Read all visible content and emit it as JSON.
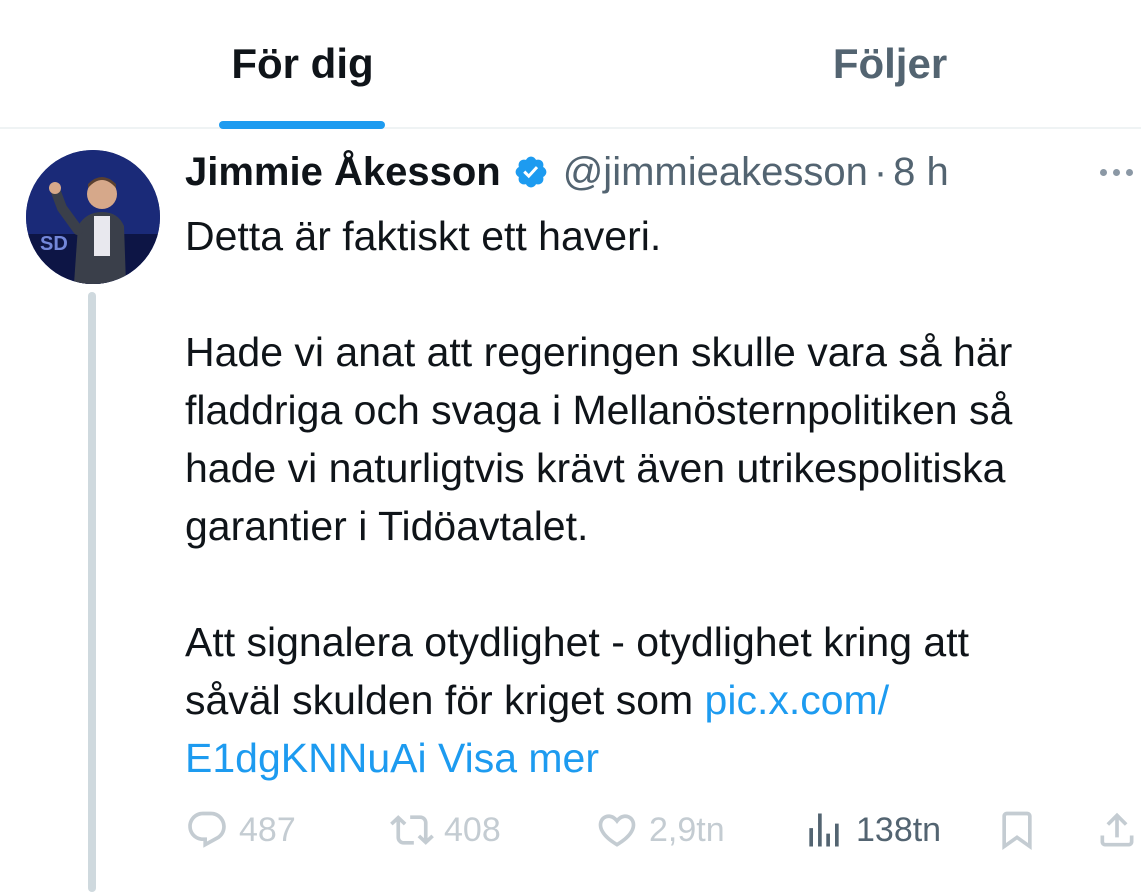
{
  "tabs": {
    "for_you": "För dig",
    "following": "Följer"
  },
  "tweet": {
    "display_name": "Jimmie Åkesson",
    "handle": "@jimmieakesson",
    "separator": "·",
    "time": "8 h",
    "lines": {
      "p1": "Detta är faktiskt ett haveri.",
      "p2_l1": "Hade vi anat att regeringen skulle vara så här",
      "p2_l2": "fladdriga och svaga i Mellanösternpolitiken så",
      "p2_l3": "hade vi naturligtvis krävt även utrikespolitiska",
      "p2_l4": "garantier i Tidöavtalet.",
      "p3_l1": "Att signalera otydlighet - otydlighet kring att",
      "p3_l2": "såväl skulden för kriget som ",
      "link_part1": "pic.x.com/",
      "link_part2": "E1dgKNNuAi",
      "show_more": "Visa mer"
    },
    "stats": {
      "replies": "487",
      "reposts": "408",
      "likes": "2,9tn",
      "views": "138tn"
    }
  },
  "icons": {
    "verified": "verified-badge-icon",
    "more": "more-options-icon",
    "reply": "reply-icon",
    "repost": "repost-icon",
    "like": "heart-icon",
    "views": "views-chart-icon",
    "bookmark": "bookmark-icon",
    "share": "share-icon"
  },
  "colors": {
    "accent": "#1d9bf0",
    "text": "#0f1419",
    "secondary": "#536471",
    "divider": "#eff3f4"
  }
}
